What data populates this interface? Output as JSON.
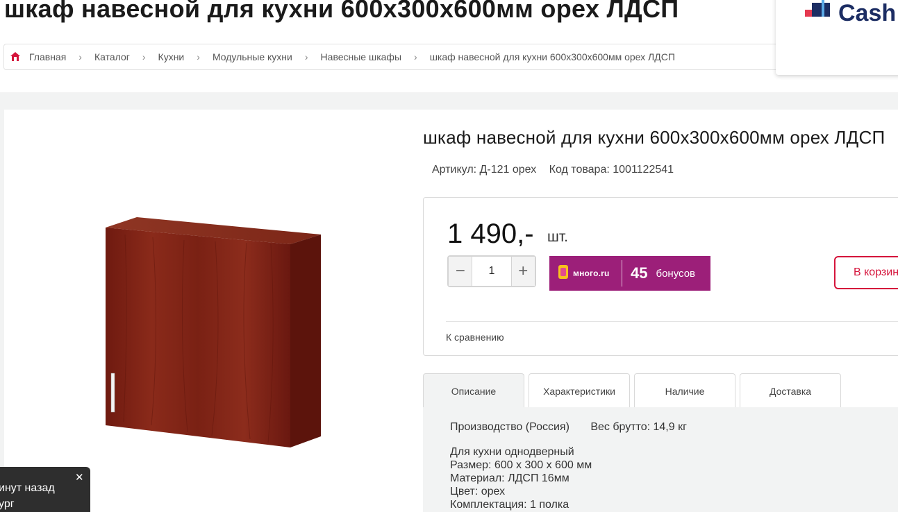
{
  "page": {
    "title": "шкаф навесной для кухни 600х300х600мм орех ЛДСП"
  },
  "breadcrumb": {
    "items": [
      "Главная",
      "Каталог",
      "Кухни",
      "Модульные кухни",
      "Навесные шкафы"
    ],
    "current": "шкаф навесной для кухни 600х300х600мм орех ЛДСП",
    "separator": "›"
  },
  "cashback": {
    "text": "Cash"
  },
  "product": {
    "name": "шкаф навесной для кухни 600х300х600мм орех ЛДСП",
    "article": "Артикул: Д-121 орех",
    "code": "Код товара: 1001122541",
    "price": "1 490,-",
    "unit": "шт.",
    "quantity": "1",
    "minus": "−",
    "plus": "+",
    "bonus": {
      "logo_text": "много.ru",
      "count": "45",
      "label": "бонусов",
      "color": "#9c1f79"
    },
    "add_to_cart": "В корзину",
    "compare": "К сравнению",
    "accent_color": "#d5143b"
  },
  "tabs": {
    "items": [
      "Описание",
      "Характеристики",
      "Наличие",
      "Доставка"
    ],
    "active": "Описание"
  },
  "description": {
    "origin": "Производство (Россия)",
    "weight": "Вес брутто: 14,9 кг",
    "lines": [
      "Для кухни однодверный",
      "Размер: 600 х 300 х 600 мм",
      "Материал: ЛДСП 16мм",
      "Цвет: орех",
      "Комплектация: 1 полка"
    ]
  },
  "toast": {
    "close": "✕",
    "line1": "инут назад",
    "line2": "ург"
  }
}
